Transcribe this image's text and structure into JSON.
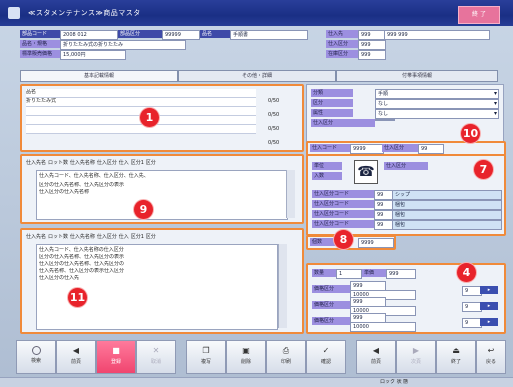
{
  "window": {
    "title": "≪スタメンテナンス≫商品マスタ",
    "close_label": "終 了"
  },
  "header": {
    "row1_label": "部品コード",
    "row1_value": "2008 012",
    "row1_label2": "部品区分",
    "row1_value2": "99999",
    "row1_label3": "品名",
    "row1_value3": "手順書",
    "row2_label": "品名・規格",
    "row2_value": "折りたたみ式の折りたたみ",
    "row3_label": "標準販売価格",
    "row3_value": "15,000円",
    "right1_label": "仕入先",
    "right1_value": "999",
    "right1_extra": "999 999",
    "right2_label": "仕入区分",
    "right2_value": "999",
    "right3_label": "在庫区分",
    "right3_value": "999"
  },
  "tabs": [
    "基本記載情報",
    "その他・詳細",
    "付帯事項情報"
  ],
  "panel1": {
    "lines": [
      "品名",
      "折りたたみ式",
      "",
      "",
      ""
    ],
    "counters": [
      "0/50",
      "0/50",
      "0/50",
      "0/50"
    ],
    "marker": "1"
  },
  "panel_right_top": {
    "labels": [
      "分類",
      "区分",
      "属性",
      "仕入区分"
    ],
    "values": [
      "手順",
      "なし",
      "なし",
      ""
    ]
  },
  "panel10": {
    "label": "仕入コード",
    "value": "9999",
    "label2": "仕入区分",
    "value2": "99",
    "marker": "10"
  },
  "panel9": {
    "header": [
      "仕入先名",
      "ロット数",
      "仕入先名称",
      "仕入区分",
      "仕入",
      "区分1",
      "区分"
    ],
    "lines": [
      "仕入先コード、仕入先名称、仕入区分、仕入先、",
      "区分の仕入先名称、仕入先区分の表示",
      "仕入区分の仕入先名称"
    ],
    "marker": "9"
  },
  "panel7": {
    "label1": "単位",
    "label2": "入数",
    "code": "仕入区分",
    "rows": [
      {
        "label": "仕入区分コード",
        "code": "99",
        "value": "シップ"
      },
      {
        "label": "仕入区分コード",
        "code": "99",
        "value": "梱包"
      },
      {
        "label": "仕入区分コード",
        "code": "99",
        "value": "梱包"
      },
      {
        "label": "仕入区分コード",
        "code": "99",
        "value": "梱包"
      }
    ],
    "marker": "7"
  },
  "panel8": {
    "label": "個数",
    "value": "9999",
    "marker": "8"
  },
  "panel4": {
    "top_label": "数量",
    "top_value": "1",
    "top_label2": "単価",
    "top_value2": "999",
    "rows": [
      {
        "label": "価格区分",
        "v1": "999",
        "v2": "10000",
        "v3": "9"
      },
      {
        "label": "価格区分",
        "v1": "999",
        "v2": "10000",
        "v3": "9"
      },
      {
        "label": "価格区分",
        "v1": "999",
        "v2": "10000",
        "v3": "9"
      }
    ],
    "marker": "4"
  },
  "panel11": {
    "header": [
      "仕入先名",
      "ロット数",
      "仕入先名称",
      "仕入区分",
      "仕入",
      "区分1",
      "区分"
    ],
    "lines": [
      "仕入先コード、仕入先名称の仕入区分",
      "区分の仕入先名称、仕入先区分の表示",
      "仕入区分の仕入先名称、仕入先区分の",
      "仕入先名称、仕入区分の表示仕入区分",
      "仕入区分の仕入先"
    ],
    "marker": "11"
  },
  "buttons": [
    {
      "label": "検索",
      "style": "normal"
    },
    {
      "label": "前頁",
      "style": "normal"
    },
    {
      "label": "登録",
      "style": "red"
    },
    {
      "label": "取消",
      "style": "dim"
    },
    {
      "label": "複写",
      "style": "normal"
    },
    {
      "label": "削除",
      "style": "normal"
    },
    {
      "label": "印刷",
      "style": "normal"
    },
    {
      "label": "確認",
      "style": "normal"
    },
    {
      "label": "前頁",
      "style": "normal"
    },
    {
      "label": "次頁",
      "style": "dim"
    },
    {
      "label": "終了",
      "style": "normal"
    },
    {
      "label": "戻る",
      "style": "normal"
    }
  ],
  "status": {
    "left": "",
    "right": "ロック 状 態"
  }
}
